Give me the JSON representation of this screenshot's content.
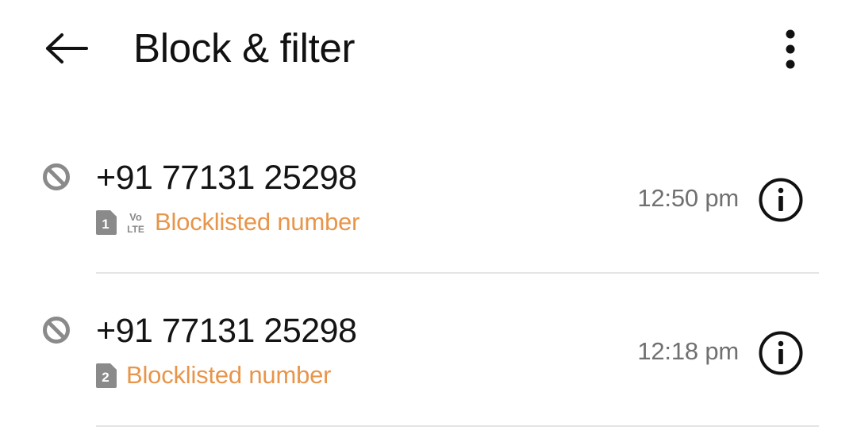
{
  "header": {
    "title": "Block & filter",
    "back_icon": "arrow-left-icon",
    "more_icon": "more-vert-icon"
  },
  "entries": [
    {
      "number": "+91 77131 25298",
      "sim": "1",
      "volte_top": "Vo",
      "volte_bottom": "LTE",
      "status": "Blocklisted number",
      "time": "12:50 pm"
    },
    {
      "number": "+91 77131 25298",
      "sim": "2",
      "status": "Blocklisted number",
      "time": "12:18 pm"
    }
  ],
  "colors": {
    "status": "#e8954a",
    "text": "#141414",
    "secondary": "#707070",
    "icon_gray": "#8a8a8a"
  }
}
